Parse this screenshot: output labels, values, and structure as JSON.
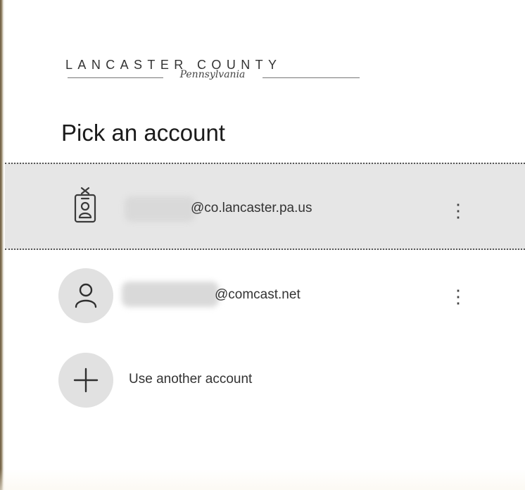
{
  "logo": {
    "main_text": "LANCASTER COUNTY",
    "script_text": "Pennsylvania"
  },
  "title": "Pick an account",
  "accounts": [
    {
      "email_suffix": "@co.lancaster.pa.us",
      "icon": "id-badge-icon",
      "selected": true,
      "menu_label": "⋮"
    },
    {
      "email_suffix": "@comcast.net",
      "icon": "person-icon",
      "selected": false,
      "menu_label": "⋮"
    }
  ],
  "use_another": {
    "label": "Use another account",
    "icon": "plus-icon"
  },
  "colors": {
    "selected_row_bg": "#e6e6e6",
    "avatar_bg": "#e1e1e1",
    "text": "#333333",
    "title": "#1b1b1b"
  }
}
